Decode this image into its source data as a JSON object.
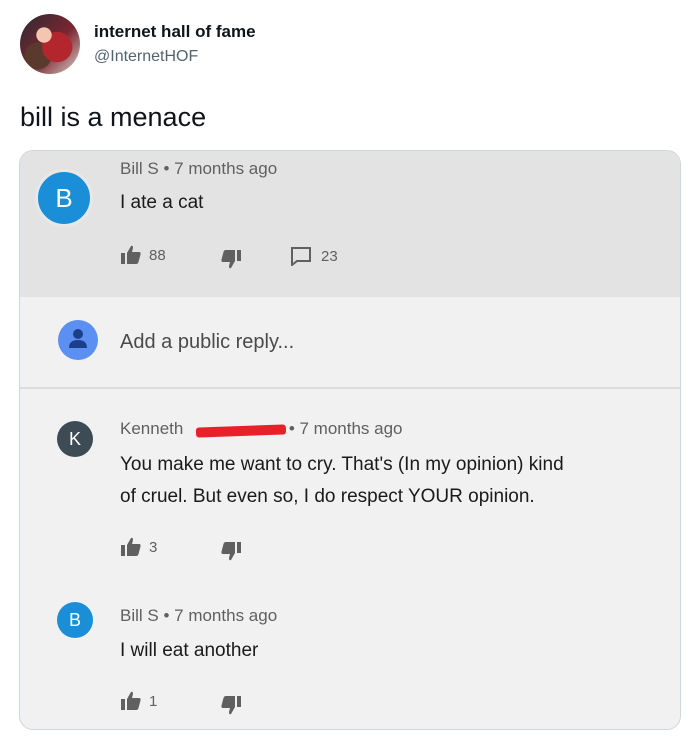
{
  "tweet": {
    "display_name": "internet hall of fame",
    "handle": "@InternetHOF",
    "text": "bill is a menace"
  },
  "comments": [
    {
      "avatar_letter": "B",
      "avatar_color": "#1a8fd8",
      "author": "Bill S",
      "time": "• 7 months ago",
      "text": "I ate a cat",
      "likes": "88",
      "replies": "23"
    },
    {
      "avatar_letter": "K",
      "avatar_color": "#3d4b55",
      "author": "Kenneth",
      "time": "• 7 months ago",
      "text_line1": "You make me want to cry. That's (In my opinion) kind",
      "text_line2": "of cruel. But even so, I do respect YOUR opinion.",
      "likes": "3"
    },
    {
      "avatar_letter": "B",
      "avatar_color": "#1a8fd8",
      "author": "Bill S",
      "time": "• 7 months ago",
      "text": "I will eat another",
      "likes": "1"
    }
  ],
  "reply_box": {
    "placeholder": "Add a public reply...",
    "avatar_color": "#5b8ff2"
  },
  "icons": [
    "thumbs-up-icon",
    "thumbs-down-icon",
    "reply-comment-icon",
    "user-icon"
  ],
  "colors": {
    "redaction": "#e8202a",
    "card_top_bg": "#e3e3e3",
    "card_bg": "#f1f1f1"
  }
}
